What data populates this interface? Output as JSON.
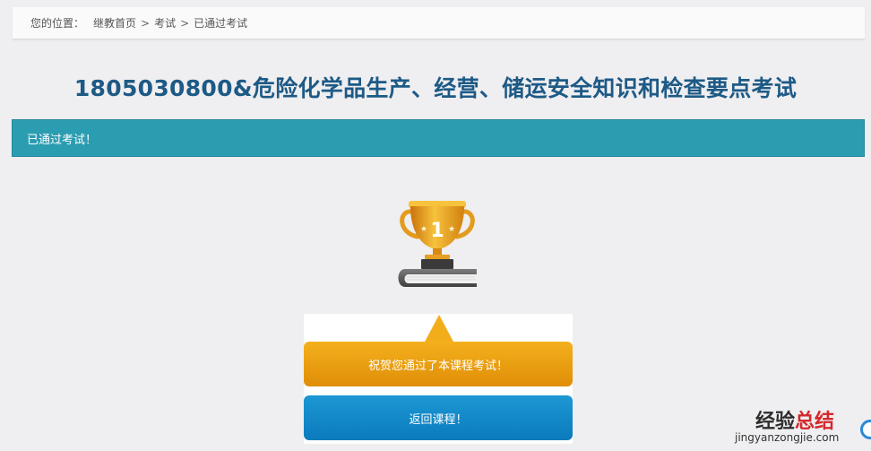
{
  "breadcrumb": {
    "label": "您的位置：",
    "items": [
      "继教首页",
      "考试",
      "已通过考试"
    ],
    "separator": ">"
  },
  "title": "1805030800&危险化学品生产、经营、储运安全知识和检查要点考试",
  "status": "已通过考试！",
  "trophy": {
    "icon": "trophy-icon",
    "rank_text": "1"
  },
  "message": "祝贺您通过了本课程考试！",
  "return_button": "返回课程！",
  "watermark": {
    "text_dark": "经验",
    "text_red": "总结",
    "url": "jingyanzongjie.com"
  },
  "colors": {
    "title": "#1d5a86",
    "status_bar": "#2b9db1",
    "congrats": "#f0a510",
    "button": "#1d8fd0"
  }
}
